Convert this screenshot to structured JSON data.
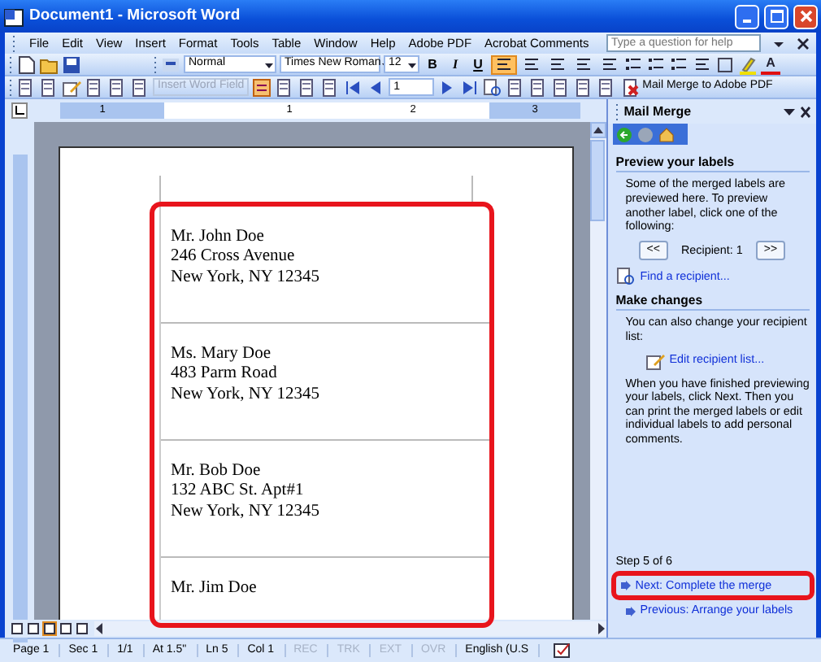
{
  "window": {
    "title": "Document1 - Microsoft Word"
  },
  "menu": [
    "File",
    "Edit",
    "View",
    "Insert",
    "Format",
    "Tools",
    "Table",
    "Window",
    "Help",
    "Adobe PDF",
    "Acrobat Comments"
  ],
  "help_box": {
    "placeholder": "Type a question for help"
  },
  "formatting_toolbar": {
    "style": "Normal",
    "font": "Times New Roman",
    "size": "12",
    "bold": "B",
    "italic": "I",
    "underline": "U",
    "font_color": "A",
    "alignment": [
      {
        "selected": true
      },
      {
        "selected": false
      },
      {
        "selected": false
      },
      {
        "selected": false
      },
      {
        "selected": false
      }
    ]
  },
  "mail_merge_toolbar": {
    "insert_field": "Insert Word Field",
    "insert_field_disabled": true,
    "record": "1",
    "merge_to_pdf": "Mail Merge to Adobe PDF"
  },
  "ruler": {
    "numbers": [
      "1",
      "1",
      "2",
      "3"
    ]
  },
  "labels": {
    "highlighted": true,
    "items": [
      {
        "lines": [
          "Mr. John Doe",
          "246 Cross Avenue",
          "New York, NY 12345"
        ]
      },
      {
        "lines": [
          "Ms. Mary Doe",
          "483 Parm Road",
          "New York, NY 12345"
        ]
      },
      {
        "lines": [
          "Mr. Bob Doe",
          "132 ABC St. Apt#1",
          "New York, NY 12345"
        ]
      },
      {
        "lines": [
          "Mr. Jim Doe"
        ]
      }
    ]
  },
  "task_pane": {
    "title": "Mail Merge",
    "preview_heading": "Preview your labels",
    "preview_text": "Some of the merged labels are previewed here. To preview another label, click one of the following:",
    "previous_button": "<<",
    "recipient": "Recipient: 1",
    "next_button": ">>",
    "find_link": "Find a recipient...",
    "changes_heading": "Make changes",
    "changes_text": "You can also change your recipient list:",
    "edit_link": "Edit recipient list...",
    "finish_text": "When you have finished previewing your labels, click Next. Then you can print the merged labels or edit individual labels to add personal comments.",
    "step": "Step 5 of 6",
    "next_step": {
      "label": "Next: Complete the merge",
      "highlighted": true
    },
    "previous_step": {
      "label": "Previous: Arrange your labels",
      "highlighted": false
    }
  },
  "status_bar": [
    {
      "text": "Page 1",
      "disabled": false
    },
    {
      "text": "Sec 1",
      "disabled": false
    },
    {
      "text": "1/1",
      "disabled": false
    },
    {
      "text": "At 1.5\"",
      "disabled": false
    },
    {
      "text": "Ln 5",
      "disabled": false
    },
    {
      "text": "Col 1",
      "disabled": false
    },
    {
      "text": "REC",
      "disabled": true
    },
    {
      "text": "TRK",
      "disabled": true
    },
    {
      "text": "EXT",
      "disabled": true
    },
    {
      "text": "OVR",
      "disabled": true
    },
    {
      "text": "English (U.S",
      "disabled": false
    }
  ]
}
